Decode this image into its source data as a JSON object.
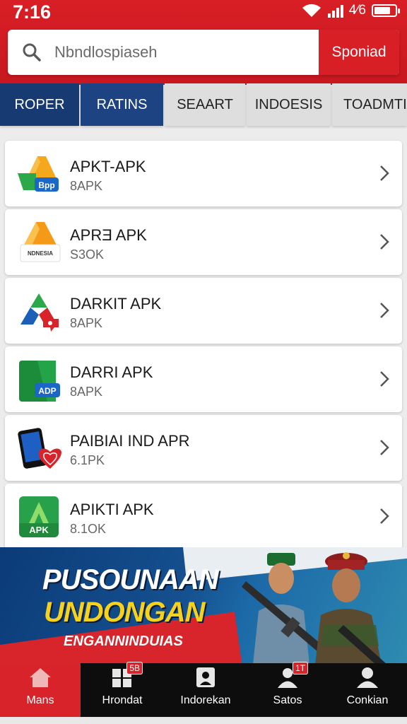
{
  "status": {
    "time": "7:16",
    "signal_text": "4⁄6"
  },
  "search": {
    "placeholder": "Nbndlospiaseh",
    "button_label": "Sponiad"
  },
  "tabs": [
    {
      "label": "ROPER"
    },
    {
      "label": "RATINS"
    },
    {
      "label": "SEAART"
    },
    {
      "label": "INDOESIS"
    },
    {
      "label": "TOADMTIA"
    }
  ],
  "apps": [
    {
      "name": "APKT-APK",
      "size": "8APK",
      "icon": "orange-a-app-icon",
      "icon_label": "Bpp"
    },
    {
      "name": "APRƎ APK",
      "size": "S3OK",
      "icon": "orange-a-indonesia-icon",
      "icon_label": "NDNESIA"
    },
    {
      "name": "DARKIT APK",
      "size": "8APK",
      "icon": "tricolor-triangle-icon",
      "icon_label": ""
    },
    {
      "name": "DARRI APK",
      "size": "8APK",
      "icon": "green-adp-icon",
      "icon_label": "ADP"
    },
    {
      "name": "PAIBIAI IND APR",
      "size": "6.1PK",
      "icon": "phone-heart-icon",
      "icon_label": ""
    },
    {
      "name": "APIKTI APK",
      "size": "8.1OK",
      "icon": "green-apk-icon",
      "icon_label": "APK"
    }
  ],
  "banner": {
    "line1": "PUSOUNAAN",
    "line2": "UNDONGAN",
    "line3": "ENGANNINDUIAS"
  },
  "nav": [
    {
      "label": "Mans",
      "icon": "home-icon",
      "badge": ""
    },
    {
      "label": "Hrondat",
      "icon": "grid-icon",
      "badge": "5B"
    },
    {
      "label": "Indorekan",
      "icon": "person-card-icon",
      "badge": ""
    },
    {
      "label": "Satos",
      "icon": "user-icon",
      "badge": "1T"
    },
    {
      "label": "Conkian",
      "icon": "account-icon",
      "badge": ""
    }
  ],
  "colors": {
    "brand_red": "#d8232a",
    "tab_blue": "#183a73",
    "banner_yellow": "#f6d21c"
  }
}
